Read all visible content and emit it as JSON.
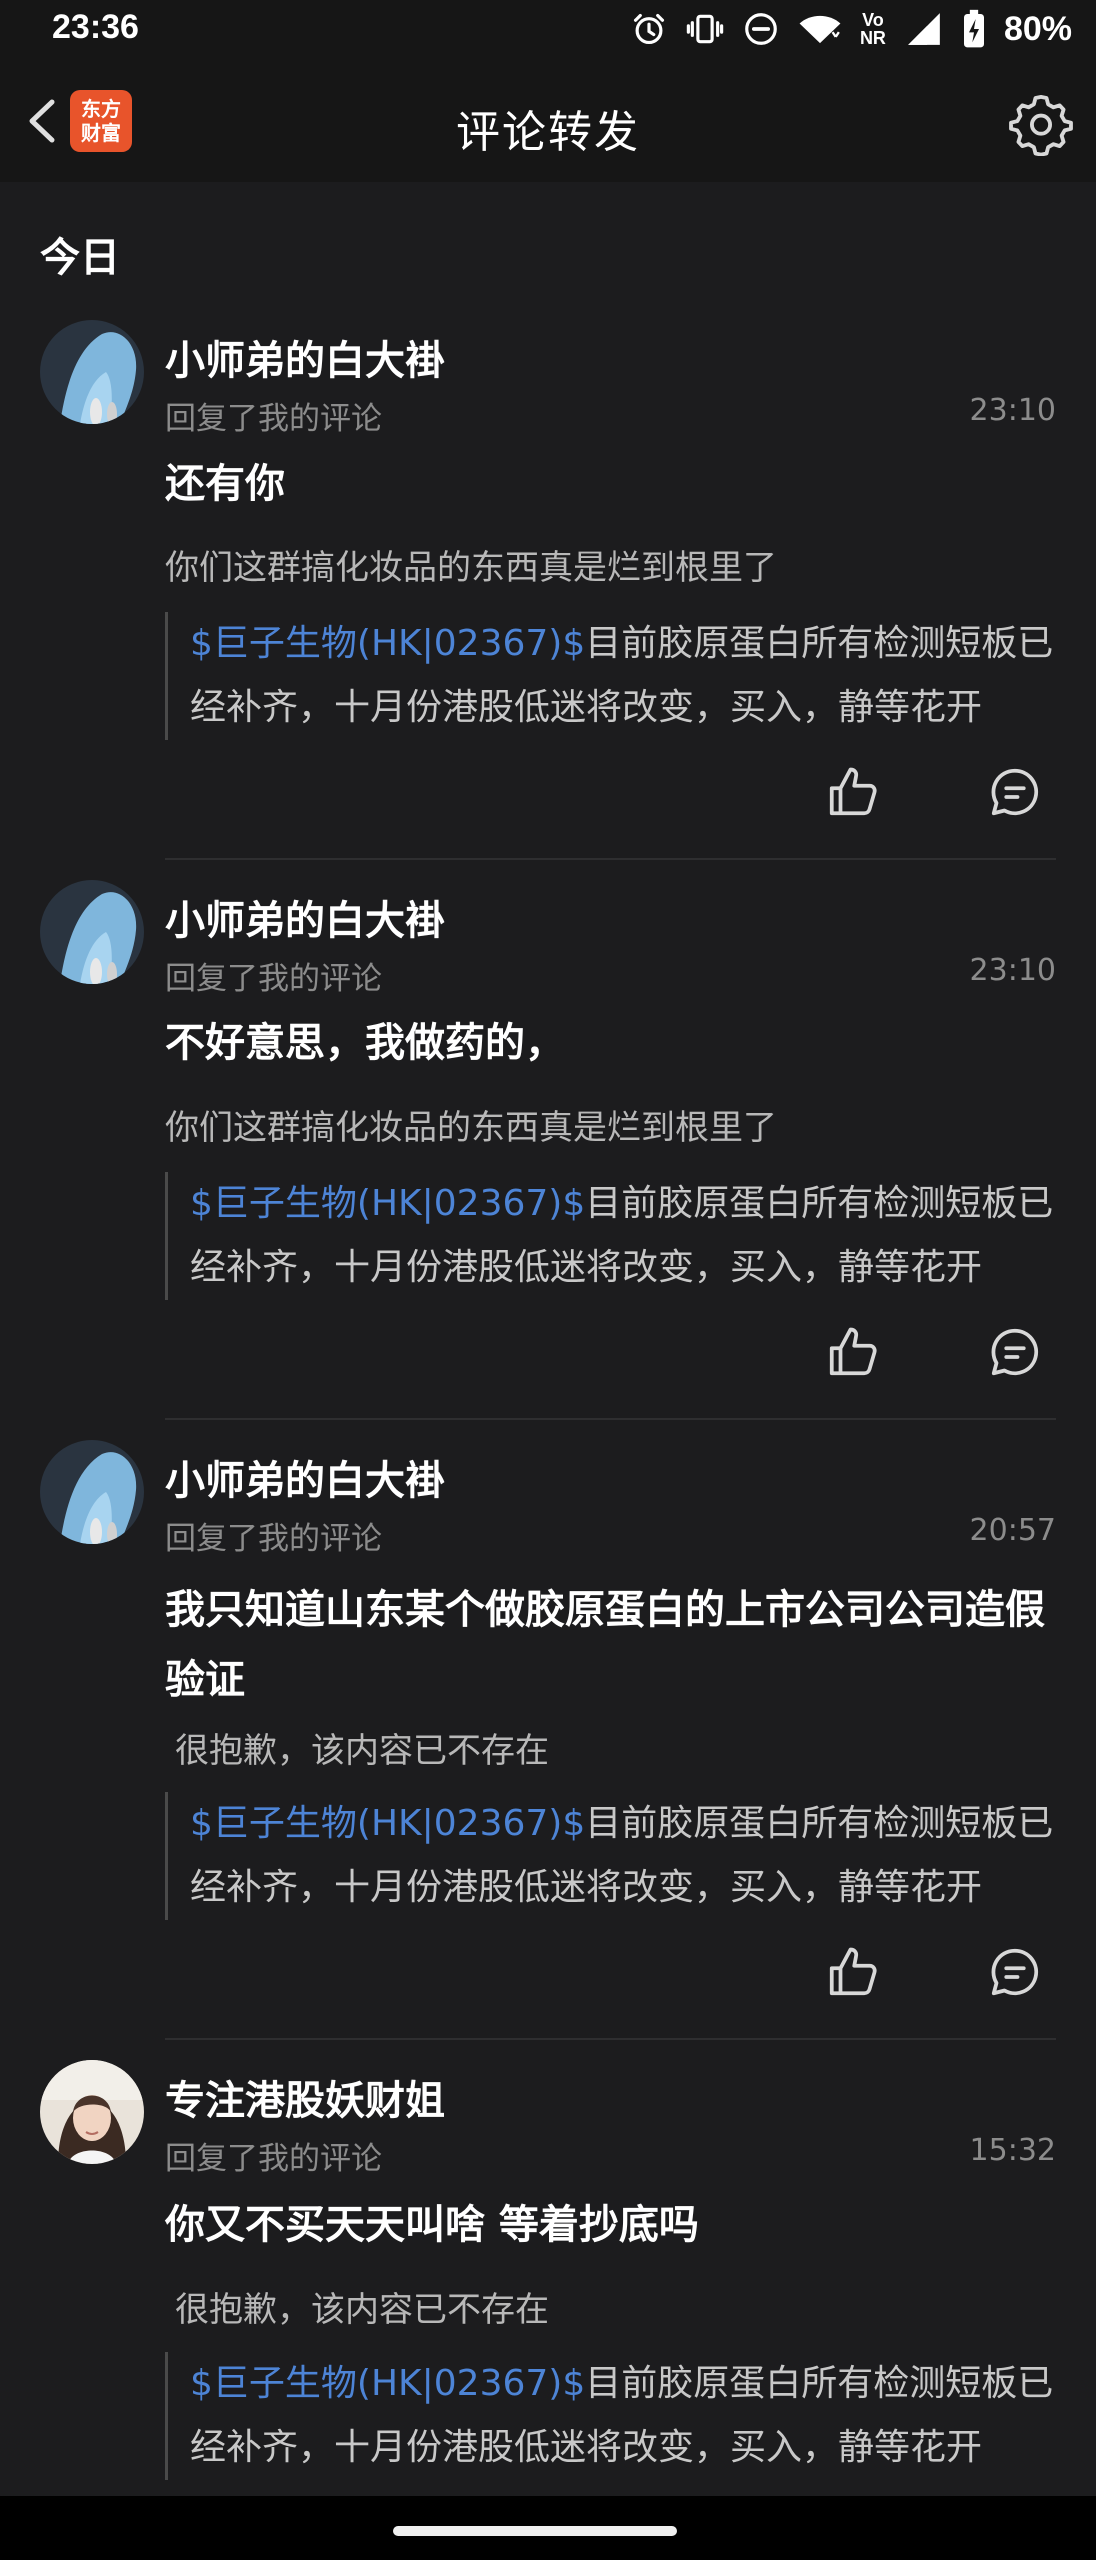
{
  "status_bar": {
    "time": "23:36",
    "battery": "80%",
    "icons": [
      "alarm-icon",
      "vibrate-icon",
      "dnd-icon",
      "wifi-icon",
      "volte-nr-icon",
      "signal-icon",
      "battery-icon"
    ],
    "volte_label": "Vo",
    "nr_label": "NR"
  },
  "nav": {
    "title": "评论转发",
    "logo_line1": "东方",
    "logo_line2": "财富",
    "back_icon": "chevron-left-icon",
    "settings_icon": "gear-icon"
  },
  "section": {
    "title": "今日"
  },
  "items": [
    {
      "user": "小师弟的白大褂",
      "action": "回复了我的评论",
      "time": "23:10",
      "reply": "还有你",
      "my_comment": "你们这群搞化妆品的东西真是烂到根里了",
      "quote_stock": "$巨子生物(HK|02367)$",
      "quote_rest": "目前胶原蛋白所有检测短板已经补齐，十月份港股低迷将改变，买入，静等花开"
    },
    {
      "user": "小师弟的白大褂",
      "action": "回复了我的评论",
      "time": "23:10",
      "reply": "不好意思，我做药的，",
      "my_comment": "你们这群搞化妆品的东西真是烂到根里了",
      "quote_stock": "$巨子生物(HK|02367)$",
      "quote_rest": "目前胶原蛋白所有检测短板已经补齐，十月份港股低迷将改变，买入，静等花开"
    },
    {
      "user": "小师弟的白大褂",
      "action": "回复了我的评论",
      "time": "20:57",
      "reply": "我只知道山东某个做胶原蛋白的上市公司公司造假验证",
      "my_comment": "很抱歉，该内容已不存在",
      "quote_stock": "$巨子生物(HK|02367)$",
      "quote_rest": "目前胶原蛋白所有检测短板已经补齐，十月份港股低迷将改变，买入，静等花开"
    },
    {
      "user": "专注港股妖财姐",
      "action": "回复了我的评论",
      "time": "15:32",
      "reply": "你又不买天天叫啥 等着抄底吗",
      "my_comment": "很抱歉，该内容已不存在",
      "quote_stock": "$巨子生物(HK|02367)$",
      "quote_rest": "目前胶原蛋白所有检测短板已经补齐，十月份港股低迷将改变，买入，静等花开"
    }
  ],
  "colors": {
    "background": "#1c1c1e",
    "bar": "#161616",
    "link": "#4d84d6",
    "logo": "#e8542b",
    "muted": "#8c8c8c"
  }
}
